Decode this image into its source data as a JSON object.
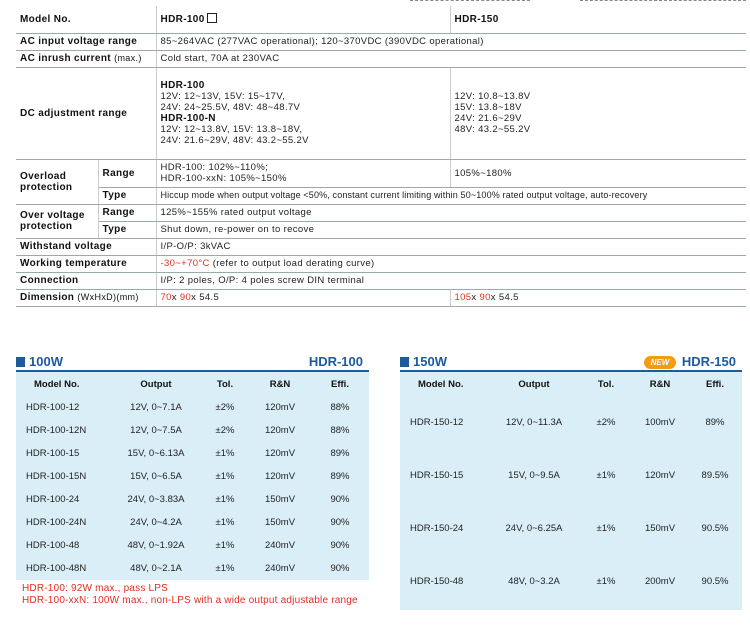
{
  "spec": {
    "model_label": "Model No.",
    "model_100": "HDR-100",
    "model_150": "HDR-150",
    "ac_input": {
      "label": "AC input voltage range",
      "value": "85~264VAC (277VAC operational); 120~370VDC (390VDC operational)"
    },
    "ac_inrush": {
      "label": "AC inrush current",
      "label_suffix": "(max.)",
      "value": "Cold start, 70A at 230VAC"
    },
    "dc_adj": {
      "label": "DC adjustment range",
      "hdr100_title": "HDR-100",
      "hdr100_line1": "12V: 12~13V, 15V: 15~17V,",
      "hdr100_line2": "24V: 24~25.5V, 48V: 48~48.7V",
      "hdr100n_title": "HDR-100-N",
      "hdr100n_line1": "12V: 12~13.8V, 15V: 13.8~18V,",
      "hdr100n_line2": "24V: 21.6~29V, 48V: 43.2~55.2V",
      "hdr150_line1": "12V: 10.8~13.8V",
      "hdr150_line2": "15V: 13.8~18V",
      "hdr150_line3": "24V: 21.6~29V",
      "hdr150_line4": "48V: 43.2~55.2V"
    },
    "overload": {
      "label_line1": "Overload",
      "label_line2": "protection",
      "range_label": "Range",
      "range_100_line1": "HDR-100: 102%~110%;",
      "range_100_line2": "HDR-100-xxN: 105%~150%",
      "range_150": "105%~180%",
      "type_label": "Type",
      "type_value": "Hiccup mode when output voltage <50%, constant current limiting within 50~100% rated output voltage, auto-recovery"
    },
    "overvoltage": {
      "label_line1": "Over voltage",
      "label_line2": "protection",
      "range_label": "Range",
      "range_value": "125%~155% rated output voltage",
      "type_label": "Type",
      "type_value": "Shut down, re-power on to recove"
    },
    "withstand": {
      "label": "Withstand voltage",
      "value": "I/P-O/P: 3kVAC"
    },
    "working_temp": {
      "label": "Working temperature",
      "value_red": "-30~+70°C",
      "value_rest": " (refer to output load derating curve)"
    },
    "connection": {
      "label": "Connection",
      "value": "I/P: 2 poles, O/P: 4 poles screw DIN terminal"
    },
    "dimension": {
      "label": "Dimension",
      "label_suffix": "(WxHxD)(mm)",
      "d100_w": "70",
      "d100_x1": "x ",
      "d100_h": "90",
      "d100_rest": "x 54.5",
      "d150_w": "105",
      "d150_x1": "x ",
      "d150_h": "90",
      "d150_rest": "x 54.5"
    }
  },
  "panel100": {
    "watt": "100W",
    "model": "HDR-100",
    "headers": [
      "Model No.",
      "Output",
      "Tol.",
      "R&N",
      "Effi."
    ],
    "rows": [
      [
        "HDR-100-12",
        "12V, 0~7.1A",
        "±2%",
        "120mV",
        "88%"
      ],
      [
        "HDR-100-12N",
        "12V, 0~7.5A",
        "±2%",
        "120mV",
        "88%"
      ],
      [
        "HDR-100-15",
        "15V, 0~6.13A",
        "±1%",
        "120mV",
        "89%"
      ],
      [
        "HDR-100-15N",
        "15V, 0~6.5A",
        "±1%",
        "120mV",
        "89%"
      ],
      [
        "HDR-100-24",
        "24V, 0~3.83A",
        "±1%",
        "150mV",
        "90%"
      ],
      [
        "HDR-100-24N",
        "24V, 0~4.2A",
        "±1%",
        "150mV",
        "90%"
      ],
      [
        "HDR-100-48",
        "48V, 0~1.92A",
        "±1%",
        "240mV",
        "90%"
      ],
      [
        "HDR-100-48N",
        "48V, 0~2.1A",
        "±1%",
        "240mV",
        "90%"
      ]
    ]
  },
  "panel150": {
    "watt": "150W",
    "badge": "NEW",
    "model": "HDR-150",
    "headers": [
      "Model No.",
      "Output",
      "Tol.",
      "R&N",
      "Effi."
    ],
    "rows": [
      [
        "HDR-150-12",
        "12V, 0~11.3A",
        "±2%",
        "100mV",
        "89%"
      ],
      [
        "HDR-150-15",
        "15V, 0~9.5A",
        "±1%",
        "120mV",
        "89.5%"
      ],
      [
        "HDR-150-24",
        "24V, 0~6.25A",
        "±1%",
        "150mV",
        "90.5%"
      ],
      [
        "HDR-150-48",
        "48V, 0~3.2A",
        "±1%",
        "200mV",
        "90.5%"
      ]
    ]
  },
  "notes": {
    "line1": "HDR-100: 92W max., pass LPS",
    "line2": "HDR-100-xxN: 100W max., non-LPS with a wide output adjustable range"
  },
  "colors": {
    "accent": "#1e5aa0",
    "panel_bg": "#d9eef6",
    "red": "#e0301e",
    "badge": "#f39a17"
  }
}
